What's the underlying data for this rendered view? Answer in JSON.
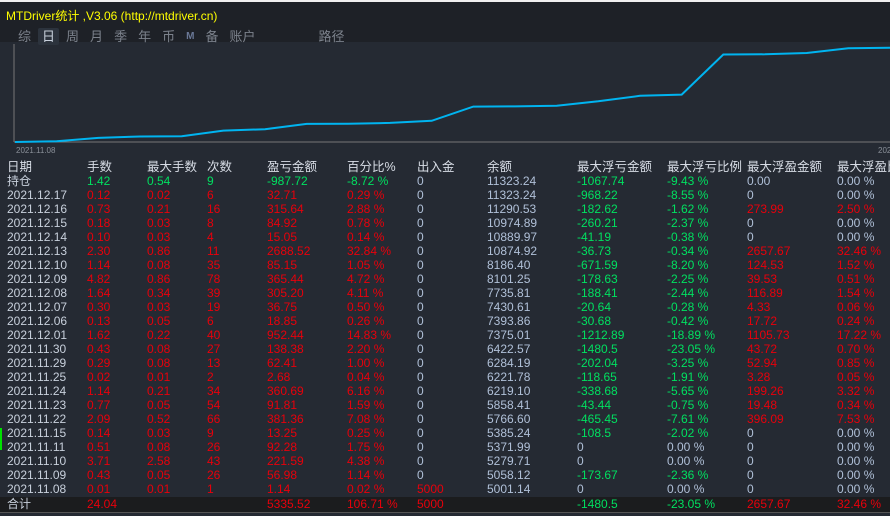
{
  "title": "MTDriver统计 ,V3.06 (http://mtdriver.cn)",
  "tabs": [
    {
      "label": "综"
    },
    {
      "label": "日",
      "active": true
    },
    {
      "label": "周"
    },
    {
      "label": "月"
    },
    {
      "label": "季"
    },
    {
      "label": "年"
    },
    {
      "label": "币"
    },
    {
      "label": "M"
    },
    {
      "label": "备"
    },
    {
      "label": "账户"
    },
    {
      "label": "路径"
    }
  ],
  "chart_data": {
    "type": "line",
    "series": [
      {
        "name": "余额",
        "color": "#00b4f0"
      }
    ],
    "x_start_label": "2021.11.08",
    "x_end_label": "202",
    "values": [
      5001.14,
      5058.12,
      5279.71,
      5371.99,
      5385.24,
      5766.6,
      5858.41,
      6219.1,
      6221.78,
      6284.19,
      6422.57,
      7375.01,
      7393.86,
      7430.61,
      7735.81,
      8101.25,
      8186.4,
      10874.92,
      10889.97,
      10974.89,
      11290.53,
      11323.24
    ]
  },
  "columns": [
    "日期",
    "手数",
    "最大手数",
    "次数",
    "盈亏金额",
    "百分比%",
    "出入金",
    "余额",
    "最大浮亏金额",
    "最大浮亏比例",
    "最大浮盈金额",
    "最大浮盈比"
  ],
  "holding": [
    "持仓",
    "1.42",
    "0.54",
    "9",
    "-987.72",
    "-8.72 %",
    "0",
    "11323.24",
    "-1067.74",
    "-9.43 %",
    "0.00",
    "0.00 %"
  ],
  "rows": [
    [
      "2021.12.17",
      "0.12",
      "0.02",
      "6",
      "32.71",
      "0.29 %",
      "0",
      "11323.24",
      "-968.22",
      "-8.55 %",
      "0",
      "0.00 %"
    ],
    [
      "2021.12.16",
      "0.73",
      "0.21",
      "16",
      "315.64",
      "2.88 %",
      "0",
      "11290.53",
      "-182.62",
      "-1.62 %",
      "273.99",
      "2.50 %"
    ],
    [
      "2021.12.15",
      "0.18",
      "0.03",
      "8",
      "84.92",
      "0.78 %",
      "0",
      "10974.89",
      "-260.21",
      "-2.37 %",
      "0",
      "0.00 %"
    ],
    [
      "2021.12.14",
      "0.10",
      "0.03",
      "4",
      "15.05",
      "0.14 %",
      "0",
      "10889.97",
      "-41.19",
      "-0.38 %",
      "0",
      "0.00 %"
    ],
    [
      "2021.12.13",
      "2.30",
      "0.86",
      "11",
      "2688.52",
      "32.84 %",
      "0",
      "10874.92",
      "-36.73",
      "-0.34 %",
      "2657.67",
      "32.46 %"
    ],
    [
      "2021.12.10",
      "1.14",
      "0.08",
      "35",
      "85.15",
      "1.05 %",
      "0",
      "8186.40",
      "-671.59",
      "-8.20 %",
      "124.53",
      "1.52 %"
    ],
    [
      "2021.12.09",
      "4.82",
      "0.86",
      "78",
      "365.44",
      "4.72 %",
      "0",
      "8101.25",
      "-178.63",
      "-2.25 %",
      "39.53",
      "0.51 %"
    ],
    [
      "2021.12.08",
      "1.64",
      "0.34",
      "39",
      "305.20",
      "4.11 %",
      "0",
      "7735.81",
      "-188.41",
      "-2.44 %",
      "116.89",
      "1.54 %"
    ],
    [
      "2021.12.07",
      "0.30",
      "0.03",
      "19",
      "36.75",
      "0.50 %",
      "0",
      "7430.61",
      "-20.64",
      "-0.28 %",
      "4.33",
      "0.06 %"
    ],
    [
      "2021.12.06",
      "0.13",
      "0.05",
      "6",
      "18.85",
      "0.26 %",
      "0",
      "7393.86",
      "-30.68",
      "-0.42 %",
      "17.72",
      "0.24 %"
    ],
    [
      "2021.12.01",
      "1.62",
      "0.22",
      "40",
      "952.44",
      "14.83 %",
      "0",
      "7375.01",
      "-1212.89",
      "-18.89 %",
      "1105.73",
      "17.22 %"
    ],
    [
      "2021.11.30",
      "0.43",
      "0.08",
      "27",
      "138.38",
      "2.20 %",
      "0",
      "6422.57",
      "-1480.5",
      "-23.05 %",
      "43.72",
      "0.70 %"
    ],
    [
      "2021.11.29",
      "0.29",
      "0.08",
      "13",
      "62.41",
      "1.00 %",
      "0",
      "6284.19",
      "-202.04",
      "-3.25 %",
      "52.94",
      "0.85 %"
    ],
    [
      "2021.11.25",
      "0.02",
      "0.01",
      "2",
      "2.68",
      "0.04 %",
      "0",
      "6221.78",
      "-118.65",
      "-1.91 %",
      "3.28",
      "0.05 %"
    ],
    [
      "2021.11.24",
      "1.14",
      "0.21",
      "34",
      "360.69",
      "6.16 %",
      "0",
      "6219.10",
      "-338.68",
      "-5.65 %",
      "199.26",
      "3.32 %"
    ],
    [
      "2021.11.23",
      "0.77",
      "0.05",
      "54",
      "91.81",
      "1.59 %",
      "0",
      "5858.41",
      "-43.44",
      "-0.75 %",
      "19.48",
      "0.34 %"
    ],
    [
      "2021.11.22",
      "2.09",
      "0.52",
      "66",
      "381.36",
      "7.08 %",
      "0",
      "5766.60",
      "-465.45",
      "-7.61 %",
      "396.09",
      "7.53 %"
    ],
    [
      "2021.11.15",
      "0.14",
      "0.03",
      "9",
      "13.25",
      "0.25 %",
      "0",
      "5385.24",
      "-108.5",
      "-2.02 %",
      "0",
      "0.00 %"
    ],
    [
      "2021.11.11",
      "0.51",
      "0.08",
      "26",
      "92.28",
      "1.75 %",
      "0",
      "5371.99",
      "0",
      "0.00 %",
      "0",
      "0.00 %"
    ],
    [
      "2021.11.10",
      "3.71",
      "2.58",
      "43",
      "221.59",
      "4.38 %",
      "0",
      "5279.71",
      "0",
      "0.00 %",
      "0",
      "0.00 %"
    ],
    [
      "2021.11.09",
      "0.43",
      "0.05",
      "26",
      "56.98",
      "1.14 %",
      "0",
      "5058.12",
      "-173.67",
      "-2.36 %",
      "0",
      "0.00 %"
    ],
    [
      "2021.11.08",
      "0.01",
      "0.01",
      "1",
      "1.14",
      "0.02 %",
      "5000",
      "5001.14",
      "0",
      "0.00 %",
      "0",
      "0.00 %"
    ]
  ],
  "total": [
    "合计",
    "24.04",
    "",
    "",
    "5335.52",
    "106.71 %",
    "5000",
    "",
    "-1480.5",
    "-23.05 %",
    "2657.67",
    "32.46 %"
  ],
  "colors": {
    "red": "#e8000b",
    "green": "#00e060",
    "line": "#00b4f0"
  }
}
